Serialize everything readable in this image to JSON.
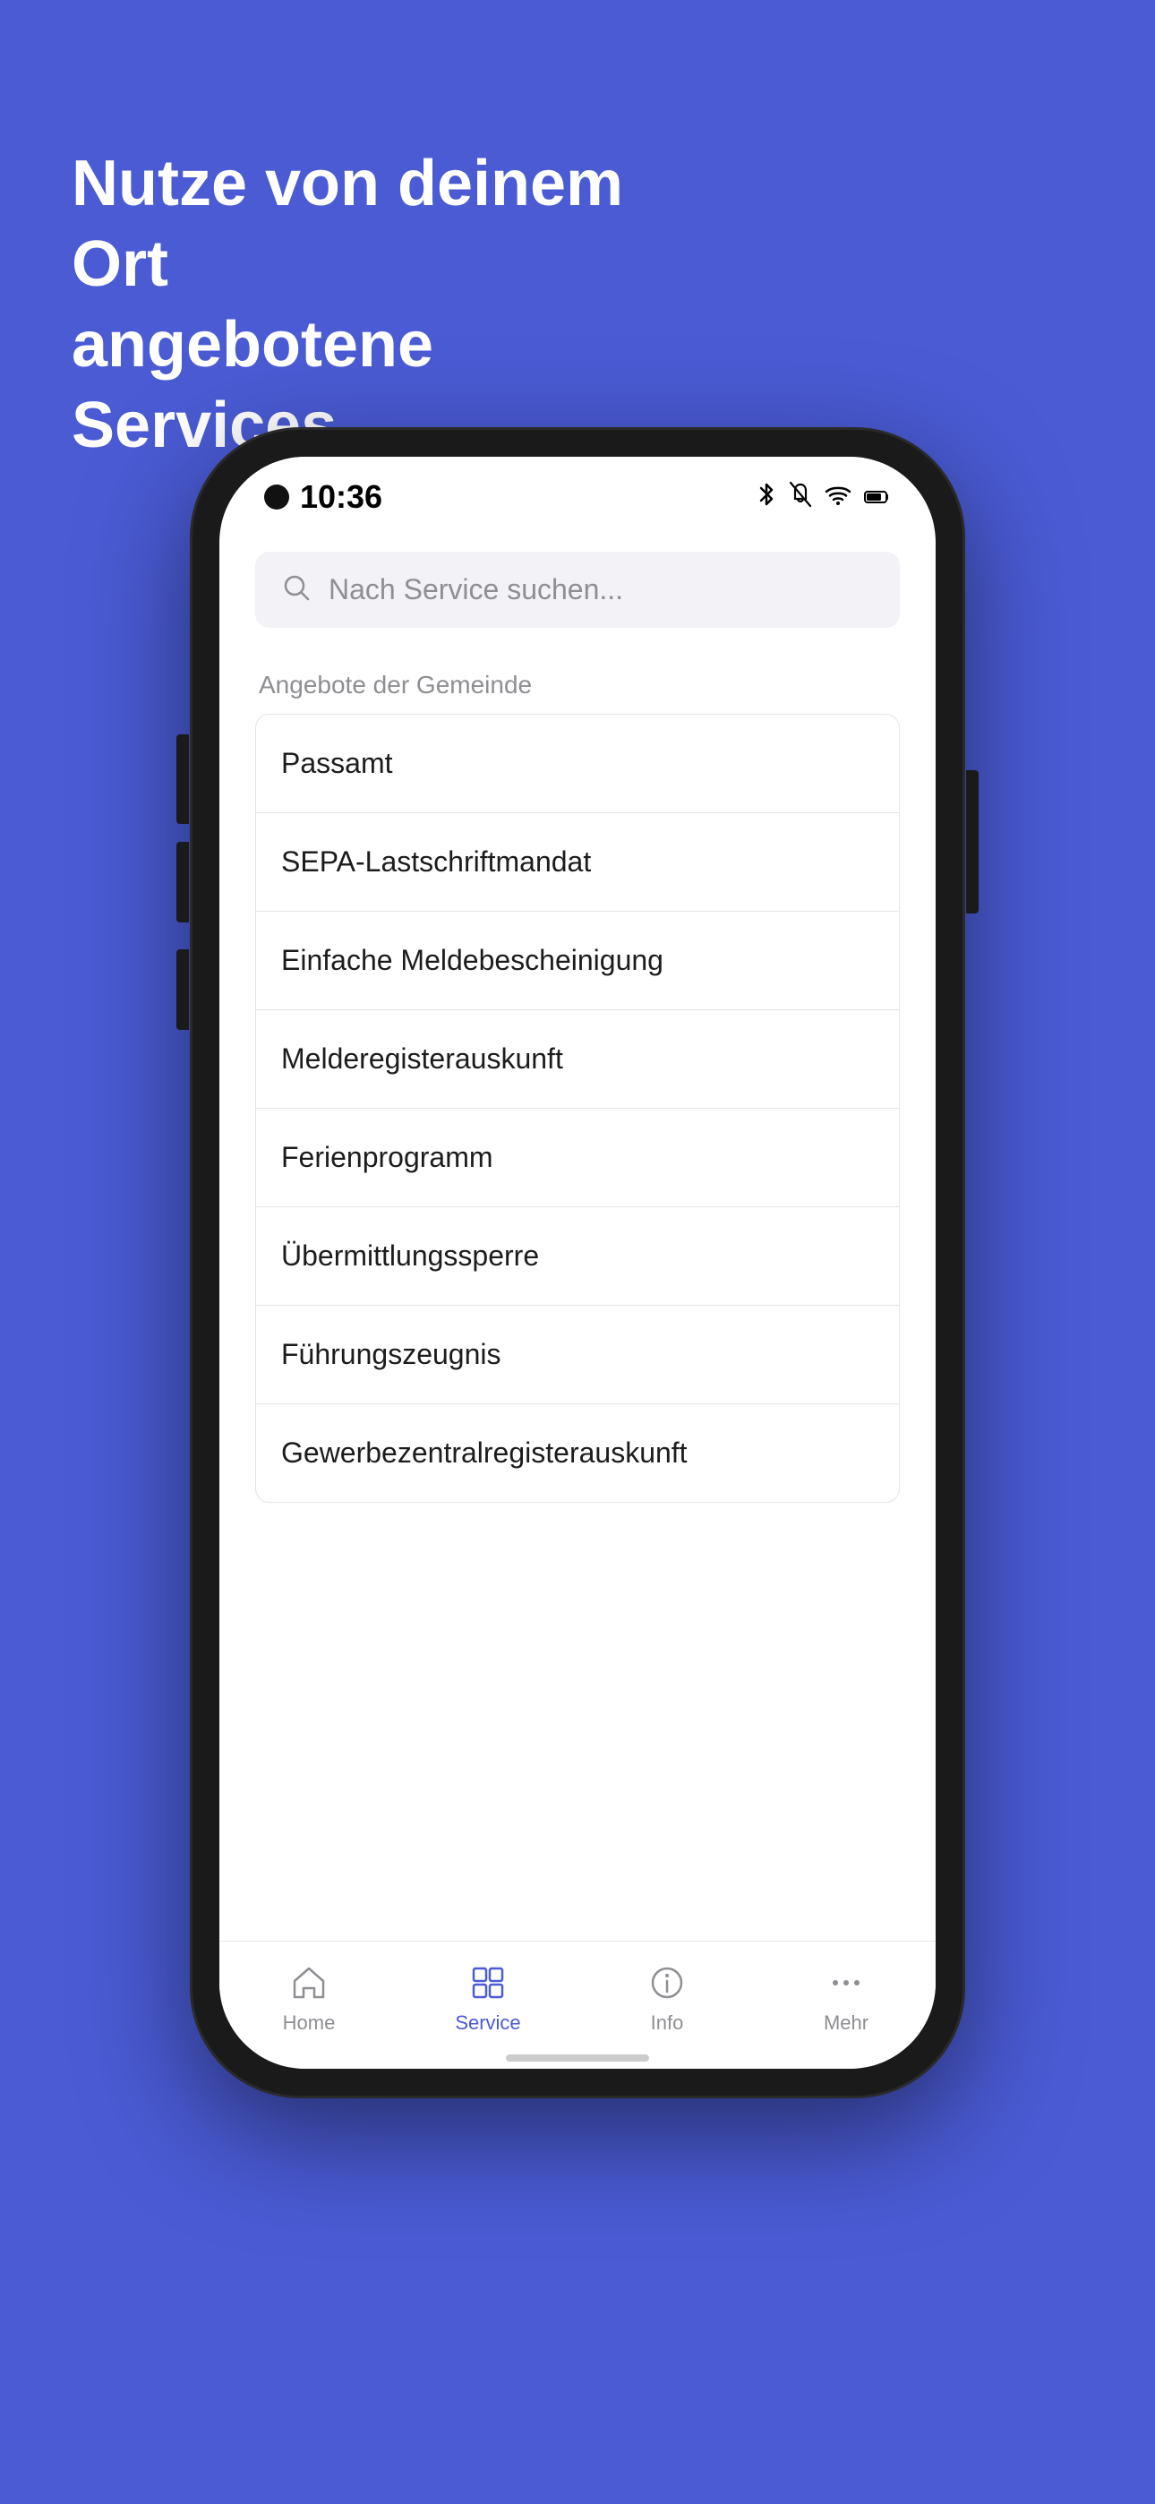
{
  "background": {
    "color": "#4a5bd4"
  },
  "headline": {
    "line1": "Nutze von deinem Ort",
    "line2": "angebotene Services"
  },
  "phone": {
    "status_bar": {
      "time": "10:36",
      "icons": [
        "bluetooth",
        "bell-off",
        "wifi",
        "battery"
      ]
    },
    "search": {
      "placeholder": "Nach Service suchen..."
    },
    "section_label": "Angebote der Gemeinde",
    "service_items": [
      {
        "label": "Passamt"
      },
      {
        "label": "SEPA-Lastschriftmandat"
      },
      {
        "label": "Einfache Meldebescheinigung"
      },
      {
        "label": "Melderegisterauskunft"
      },
      {
        "label": "Ferienprogramm"
      },
      {
        "label": "Übermittlungssperre"
      },
      {
        "label": "Führungszeugnis"
      },
      {
        "label": "Gewerbezentralregisterauskunft"
      }
    ],
    "bottom_nav": [
      {
        "id": "home",
        "label": "Home",
        "active": false
      },
      {
        "id": "service",
        "label": "Service",
        "active": true
      },
      {
        "id": "info",
        "label": "Info",
        "active": false
      },
      {
        "id": "mehr",
        "label": "Mehr",
        "active": false
      }
    ]
  }
}
